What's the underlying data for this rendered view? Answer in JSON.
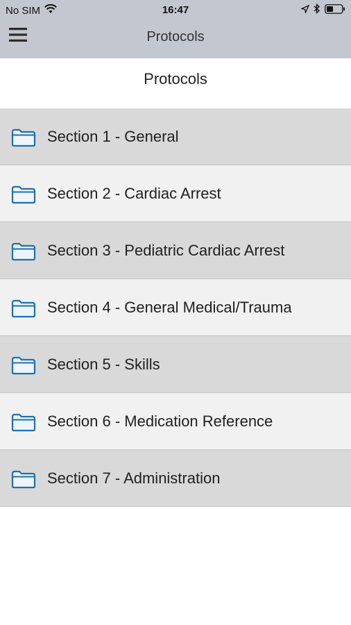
{
  "status_bar": {
    "carrier": "No SIM",
    "time": "16:47",
    "icons": [
      "wifi-icon",
      "location-arrow-icon",
      "bluetooth-icon",
      "battery-icon"
    ]
  },
  "nav_bar": {
    "title": "Protocols",
    "menu_icon": "hamburger-menu-icon"
  },
  "page": {
    "heading": "Protocols"
  },
  "sections": [
    {
      "label": "Section 1 - General",
      "icon": "folder-icon"
    },
    {
      "label": "Section 2 - Cardiac Arrest",
      "icon": "folder-icon"
    },
    {
      "label": "Section 3 - Pediatric Cardiac Arrest",
      "icon": "folder-icon"
    },
    {
      "label": "Section 4 - General Medical/Trauma",
      "icon": "folder-icon"
    },
    {
      "label": "Section 5 - Skills",
      "icon": "folder-icon"
    },
    {
      "label": "Section 6 - Medication Reference",
      "icon": "folder-icon"
    },
    {
      "label": "Section 7 - Administration",
      "icon": "folder-icon"
    }
  ],
  "colors": {
    "nav_background": "#c3c8d0",
    "row_dark": "#d9d9d9",
    "row_light": "#f1f1f1",
    "folder_stroke": "#1e6fb0"
  }
}
